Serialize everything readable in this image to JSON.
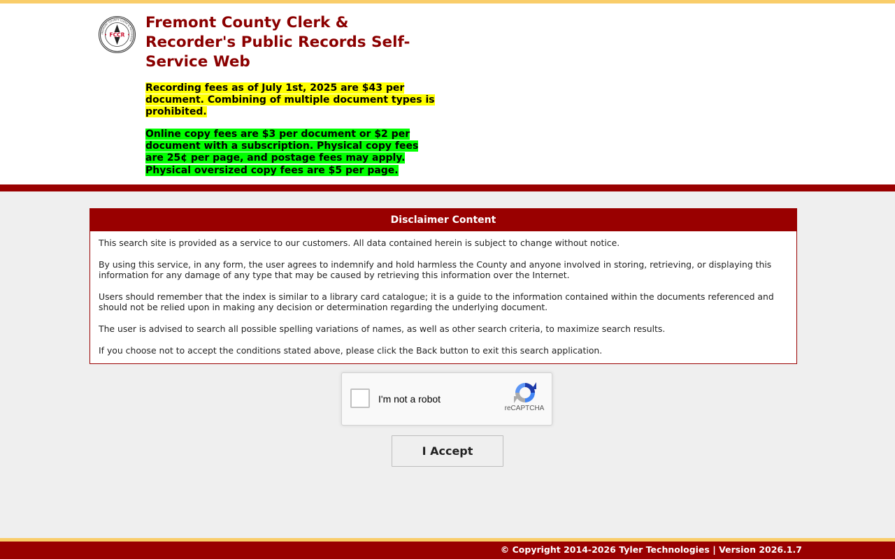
{
  "header": {
    "title": "Fremont County Clerk & Recorder's Public Records Self-Service Web",
    "logo_text": "FREMONT COUNTY CLERK & RECORDER",
    "logo_initials": "FCCR",
    "notice_fees": "Recording fees as of July 1st, 2025 are $43 per document.  Combining of multiple document types is prohibited.",
    "notice_copy": "Online copy fees are $3 per document or $2 per document with a subscription.  Physical copy fees are 25¢ per page, and postage fees may apply.  Physical oversized copy fees are $5 per page."
  },
  "disclaimer": {
    "title": "Disclaimer Content",
    "paragraphs": [
      "This search site is provided as a service to our customers. All data contained herein is subject to change without notice.",
      "By using this service, in any form, the user agrees to indemnify and hold harmless the County and anyone involved in storing, retrieving, or displaying this information for any damage of any type that may be caused by retrieving this information over the Internet.",
      "Users should remember that the index is similar to a library card catalogue; it is a guide to the information contained within the documents referenced and should not be relied upon in making any decision or determination regarding the underlying document.",
      "The user is advised to search all possible spelling variations of names, as well as other search criteria, to maximize search results.",
      "If you choose not to accept the conditions stated above, please click the Back button to exit this search application."
    ]
  },
  "captcha": {
    "label": "I'm not a robot",
    "brand": "reCAPTCHA",
    "icon": "recaptcha-icon"
  },
  "accept_label": "I Accept",
  "footer": {
    "copyright": "© Copyright 2014-2026 Tyler Technologies | Version 2026.1.7"
  },
  "colors": {
    "brand_red": "#990000",
    "title_red": "#8b0000",
    "gold": "#f9cd6a",
    "highlight_yellow": "#ffff00",
    "highlight_green": "#00ff00"
  }
}
